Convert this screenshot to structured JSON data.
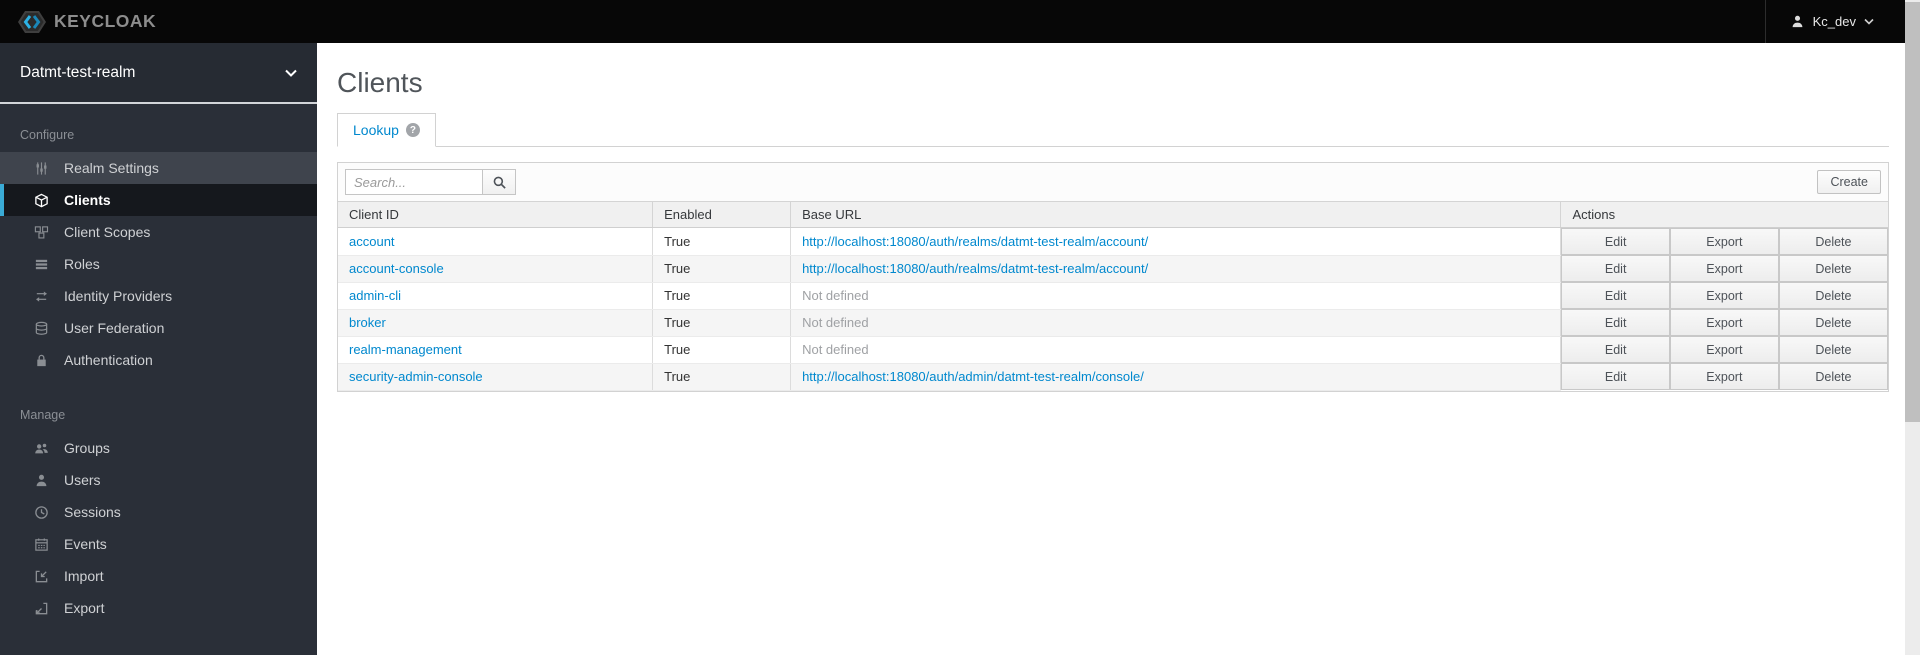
{
  "topbar": {
    "brand": "KEYCLOAK",
    "user": {
      "name": "Kc_dev"
    }
  },
  "sidebar": {
    "realm": "Datmt-test-realm",
    "sections": [
      {
        "label": "Configure",
        "items": [
          {
            "label": "Realm Settings",
            "icon": "sliders-icon"
          },
          {
            "label": "Clients",
            "icon": "cube-icon",
            "active": true
          },
          {
            "label": "Client Scopes",
            "icon": "cubes-icon"
          },
          {
            "label": "Roles",
            "icon": "list-icon"
          },
          {
            "label": "Identity Providers",
            "icon": "exchange-icon"
          },
          {
            "label": "User Federation",
            "icon": "database-icon"
          },
          {
            "label": "Authentication",
            "icon": "lock-icon"
          }
        ]
      },
      {
        "label": "Manage",
        "items": [
          {
            "label": "Groups",
            "icon": "group-icon"
          },
          {
            "label": "Users",
            "icon": "user-icon"
          },
          {
            "label": "Sessions",
            "icon": "clock-icon"
          },
          {
            "label": "Events",
            "icon": "calendar-icon"
          },
          {
            "label": "Import",
            "icon": "import-icon"
          },
          {
            "label": "Export",
            "icon": "export-icon"
          }
        ]
      }
    ]
  },
  "main": {
    "title": "Clients",
    "tabs": [
      {
        "label": "Lookup",
        "active": true
      }
    ],
    "toolbar": {
      "search_placeholder": "Search...",
      "create_label": "Create"
    },
    "table": {
      "headers": [
        "Client ID",
        "Enabled",
        "Base URL",
        "Actions"
      ],
      "action_labels": [
        "Edit",
        "Export",
        "Delete"
      ],
      "rows": [
        {
          "client_id": "account",
          "enabled": "True",
          "base_url": "http://localhost:18080/auth/realms/datmt-test-realm/account/",
          "url_defined": true
        },
        {
          "client_id": "account-console",
          "enabled": "True",
          "base_url": "http://localhost:18080/auth/realms/datmt-test-realm/account/",
          "url_defined": true
        },
        {
          "client_id": "admin-cli",
          "enabled": "True",
          "base_url": "Not defined",
          "url_defined": false
        },
        {
          "client_id": "broker",
          "enabled": "True",
          "base_url": "Not defined",
          "url_defined": false
        },
        {
          "client_id": "realm-management",
          "enabled": "True",
          "base_url": "Not defined",
          "url_defined": false
        },
        {
          "client_id": "security-admin-console",
          "enabled": "True",
          "base_url": "http://localhost:18080/auth/admin/datmt-test-realm/console/",
          "url_defined": true
        }
      ]
    }
  },
  "colors": {
    "link": "#0088ce",
    "active_indicator": "#3aabd6",
    "topbar_bg": "#070707",
    "sidebar_bg": "#2a2f38",
    "brand_cyan": "#2cb2e5"
  }
}
